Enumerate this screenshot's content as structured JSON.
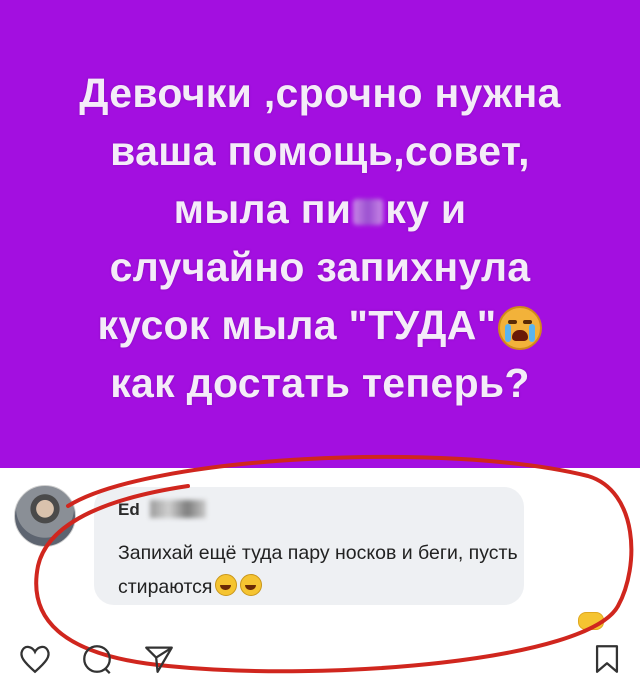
{
  "post": {
    "background_color": "#a30fe0",
    "lines": [
      "Девочки ,срочно нужна",
      "ваша помощь,совет,",
      "мыла пи",
      "ку и",
      "случайно запихнула",
      "кусок мыла \"ТУДА\"",
      "как достать теперь?"
    ],
    "censored_icon": "blurred-text",
    "emoji": "crying-face-icon"
  },
  "comment": {
    "author_visible": "Ed",
    "text": "Запихай ещё туда пару носков и беги,  пусть стираются",
    "emojis": [
      "laughing-face-icon",
      "laughing-face-icon"
    ]
  },
  "actions": {
    "icons": [
      "heart-icon",
      "comment-icon",
      "send-icon",
      "bookmark-icon"
    ]
  },
  "annotation": {
    "circle_color": "#d0261e"
  }
}
